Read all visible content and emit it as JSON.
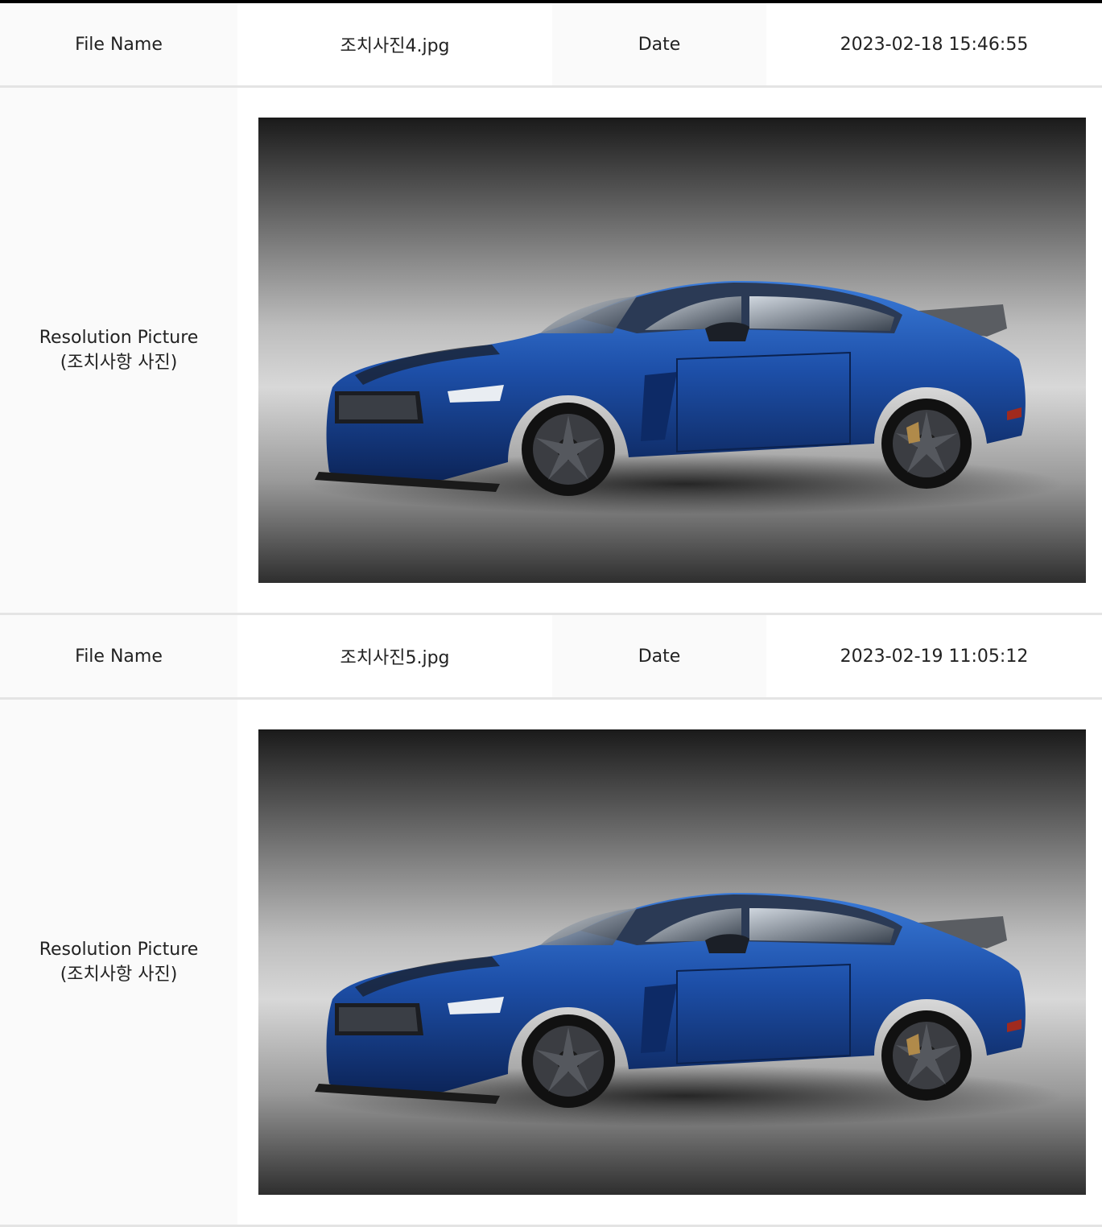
{
  "records": [
    {
      "file_name_label": "File Name",
      "file_name": "조치사진4.jpg",
      "date_label": "Date",
      "date": "2023-02-18 15:46:55",
      "picture_label_line1": "Resolution Picture",
      "picture_label_line2": "(조치사항 사진)",
      "photo_icon": "sports-car-photo"
    },
    {
      "file_name_label": "File Name",
      "file_name": "조치사진5.jpg",
      "date_label": "Date",
      "date": "2023-02-19 11:05:12",
      "picture_label_line1": "Resolution Picture",
      "picture_label_line2": "(조치사항 사진)",
      "photo_icon": "sports-car-photo"
    }
  ],
  "colors": {
    "car_body": "#1d4fa8",
    "label_background": "#fafafa",
    "divider": "#e4e4e4"
  }
}
